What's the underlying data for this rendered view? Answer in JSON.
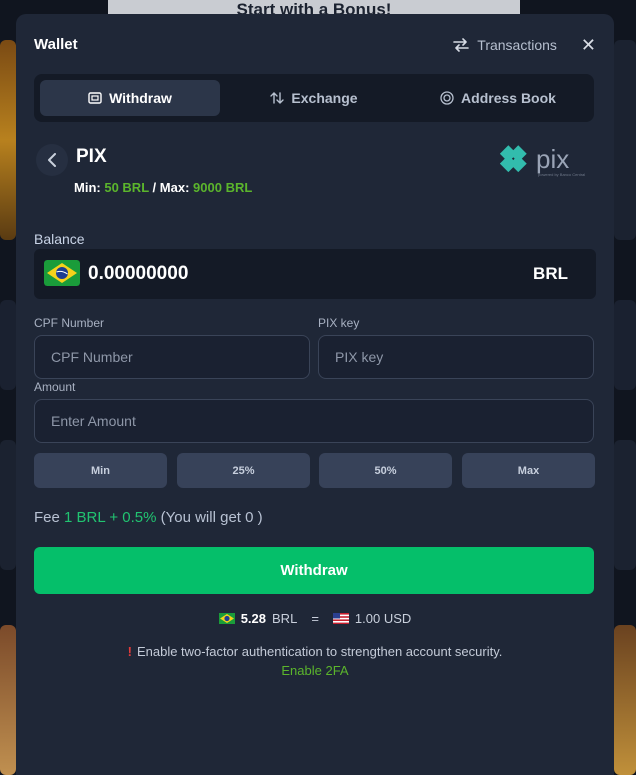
{
  "background": {
    "banner_text": "Start with a Bonus!"
  },
  "header": {
    "title": "Wallet",
    "transactions_label": "Transactions"
  },
  "tabs": [
    {
      "label": "Withdraw",
      "icon": "wallet-icon",
      "active": true
    },
    {
      "label": "Exchange",
      "icon": "exchange-icon",
      "active": false
    },
    {
      "label": "Address Book",
      "icon": "address-book-icon",
      "active": false
    }
  ],
  "method": {
    "name": "PIX",
    "min_label": "Min:",
    "min_value": "50 BRL",
    "separator": "/",
    "max_label": "Max:",
    "max_value": "9000 BRL",
    "logo_text": "pix",
    "logo_sub": "powered by Banco Central"
  },
  "balance": {
    "label": "Balance",
    "value": "0.00000000",
    "currency": "BRL"
  },
  "form": {
    "cpf_label": "CPF Number",
    "cpf_placeholder": "CPF Number",
    "pix_label": "PIX key",
    "pix_placeholder": "PIX key",
    "amount_label": "Amount",
    "amount_placeholder": "Enter Amount",
    "quick": [
      "Min",
      "25%",
      "50%",
      "Max"
    ]
  },
  "fee": {
    "prefix": "Fee",
    "value": "1 BRL + 0.5%",
    "suffix": "(You will get 0 )"
  },
  "withdraw_button": "Withdraw",
  "rate": {
    "left_value": "5.28",
    "left_currency": "BRL",
    "equals": "=",
    "right_value": "1.00 USD"
  },
  "security": {
    "warning": "Enable two-factor authentication to strengthen account security.",
    "enable_link": "Enable 2FA"
  },
  "colors": {
    "accent_green": "#05bf6a",
    "highlight_green": "#5bb52c",
    "pix_teal": "#32bcad"
  }
}
